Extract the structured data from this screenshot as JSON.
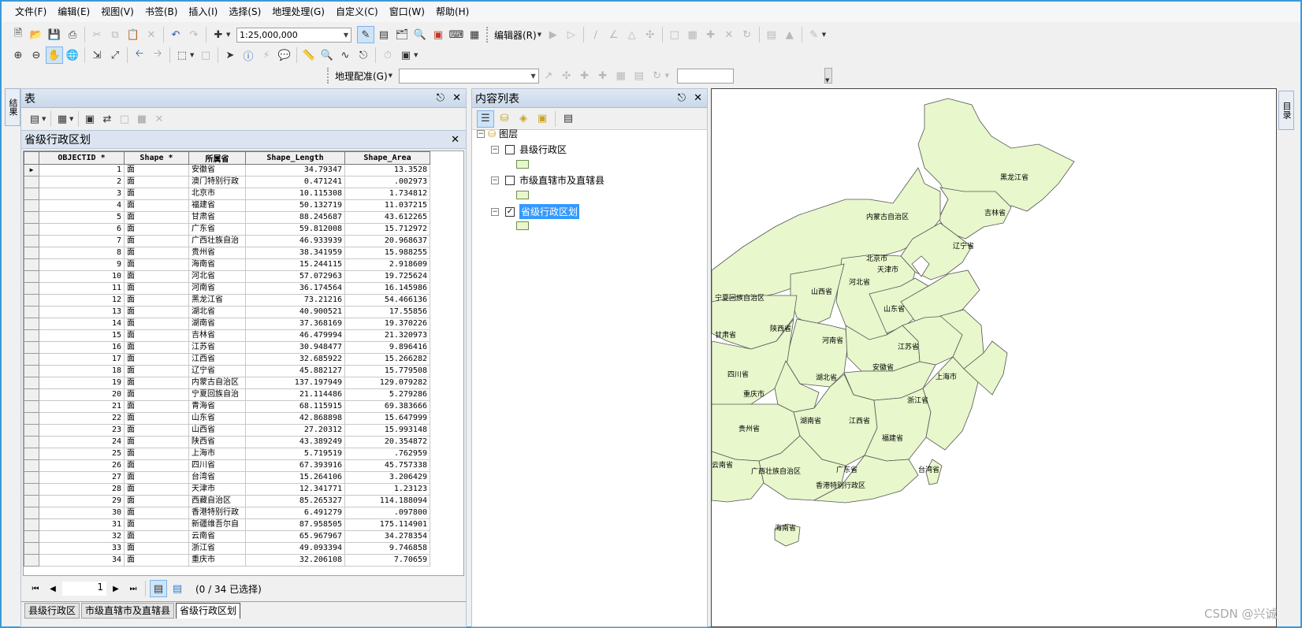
{
  "menubar": {
    "items": [
      "文件(F)",
      "编辑(E)",
      "视图(V)",
      "书签(B)",
      "插入(I)",
      "选择(S)",
      "地理处理(G)",
      "自定义(C)",
      "窗口(W)",
      "帮助(H)"
    ]
  },
  "toolbar": {
    "scale_value": "1:25,000,000",
    "editor_label": "编辑器(R)",
    "georef_label": "地理配准(G)"
  },
  "side_tabs": {
    "left": "结果",
    "right": "目录"
  },
  "table_panel": {
    "title": "表",
    "subtab_title": "省级行政区划",
    "columns": [
      "OBJECTID *",
      "Shape *",
      "所属省",
      "Shape_Length",
      "Shape_Area"
    ],
    "rows": [
      [
        "1",
        "面",
        "安徽省",
        "34.79347",
        "13.3528"
      ],
      [
        "2",
        "面",
        "澳门特别行政",
        "0.471241",
        ".002973"
      ],
      [
        "3",
        "面",
        "北京市",
        "10.115308",
        "1.734812"
      ],
      [
        "4",
        "面",
        "福建省",
        "50.132719",
        "11.037215"
      ],
      [
        "5",
        "面",
        "甘肃省",
        "88.245687",
        "43.612265"
      ],
      [
        "6",
        "面",
        "广东省",
        "59.812008",
        "15.712972"
      ],
      [
        "7",
        "面",
        "广西壮族自治",
        "46.933939",
        "20.968637"
      ],
      [
        "8",
        "面",
        "贵州省",
        "38.341959",
        "15.988255"
      ],
      [
        "9",
        "面",
        "海南省",
        "15.244115",
        "2.918609"
      ],
      [
        "10",
        "面",
        "河北省",
        "57.072963",
        "19.725624"
      ],
      [
        "11",
        "面",
        "河南省",
        "36.174564",
        "16.145986"
      ],
      [
        "12",
        "面",
        "黑龙江省",
        "73.21216",
        "54.466136"
      ],
      [
        "13",
        "面",
        "湖北省",
        "40.900521",
        "17.55856"
      ],
      [
        "14",
        "面",
        "湖南省",
        "37.368169",
        "19.370226"
      ],
      [
        "15",
        "面",
        "吉林省",
        "46.479994",
        "21.320973"
      ],
      [
        "16",
        "面",
        "江苏省",
        "30.948477",
        "9.896416"
      ],
      [
        "17",
        "面",
        "江西省",
        "32.685922",
        "15.266282"
      ],
      [
        "18",
        "面",
        "辽宁省",
        "45.882127",
        "15.779508"
      ],
      [
        "19",
        "面",
        "内蒙古自治区",
        "137.197949",
        "129.079282"
      ],
      [
        "20",
        "面",
        "宁夏回族自治",
        "21.114486",
        "5.279286"
      ],
      [
        "21",
        "面",
        "青海省",
        "68.115915",
        "69.383666"
      ],
      [
        "22",
        "面",
        "山东省",
        "42.868898",
        "15.647999"
      ],
      [
        "23",
        "面",
        "山西省",
        "27.20312",
        "15.993148"
      ],
      [
        "24",
        "面",
        "陕西省",
        "43.389249",
        "20.354872"
      ],
      [
        "25",
        "面",
        "上海市",
        "5.719519",
        ".762959"
      ],
      [
        "26",
        "面",
        "四川省",
        "67.393916",
        "45.757338"
      ],
      [
        "27",
        "面",
        "台湾省",
        "15.264106",
        "3.206429"
      ],
      [
        "28",
        "面",
        "天津市",
        "12.341771",
        "1.23123"
      ],
      [
        "29",
        "面",
        "西藏自治区",
        "85.265327",
        "114.188094"
      ],
      [
        "30",
        "面",
        "香港特别行政",
        "6.491279",
        ".097800"
      ],
      [
        "31",
        "面",
        "新疆维吾尔自",
        "87.958505",
        "175.114901"
      ],
      [
        "32",
        "面",
        "云南省",
        "65.967967",
        "34.278354"
      ],
      [
        "33",
        "面",
        "浙江省",
        "49.093394",
        "9.746858"
      ],
      [
        "34",
        "面",
        "重庆市",
        "32.206108",
        "7.70659"
      ]
    ],
    "current_page": "1",
    "selection_status": "(0 / 34 已选择)",
    "bottom_tabs": [
      "县级行政区",
      "市级直辖市及直辖县",
      "省级行政区划"
    ]
  },
  "toc_panel": {
    "title": "内容列表",
    "root_label": "图层",
    "layers": [
      {
        "name": "县级行政区",
        "checked": false
      },
      {
        "name": "市级直辖市及直辖县",
        "checked": false
      },
      {
        "name": "省级行政区划",
        "checked": true
      }
    ]
  },
  "map": {
    "fill_color": "#e8f7cc",
    "labels": [
      "黑龙江省",
      "吉林省",
      "内蒙古自治区",
      "辽宁省",
      "北京市",
      "天津市",
      "河北省",
      "山西省",
      "宁夏回族自治区",
      "山东省",
      "陕西省",
      "甘肃省",
      "河南省",
      "江苏省",
      "安徽省",
      "四川省",
      "湖北省",
      "上海市",
      "重庆市",
      "浙江省",
      "贵州省",
      "湖南省",
      "江西省",
      "福建省",
      "云南省",
      "广西壮族自治区",
      "广东省",
      "台湾省",
      "香港特别行政区",
      "海南省"
    ]
  },
  "watermark": "CSDN @兴诚"
}
